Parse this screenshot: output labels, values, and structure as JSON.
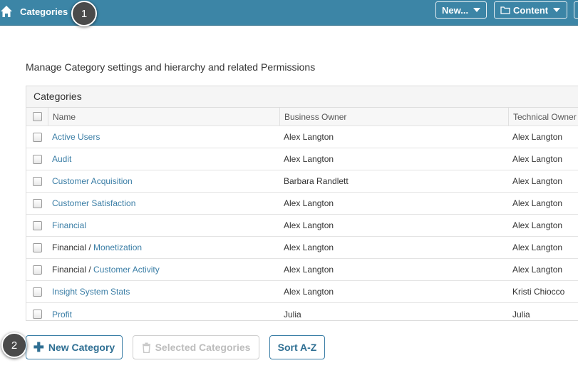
{
  "topbar": {
    "breadcrumb": "Categories",
    "new_label": "New...",
    "content_label": "Content"
  },
  "steps": {
    "one": "1",
    "two": "2"
  },
  "intro": "Manage Category settings and hierarchy and related Permissions",
  "table": {
    "title": "Categories",
    "columns": [
      "Name",
      "Business Owner",
      "Technical Owner"
    ],
    "rows": [
      {
        "prefix": "",
        "name": "Active Users",
        "business_owner": "Alex Langton",
        "technical_owner": "Alex Langton"
      },
      {
        "prefix": "",
        "name": "Audit",
        "business_owner": "Alex Langton",
        "technical_owner": "Alex Langton"
      },
      {
        "prefix": "",
        "name": "Customer Acquisition",
        "business_owner": "Barbara Randlett",
        "technical_owner": "Alex Langton"
      },
      {
        "prefix": "",
        "name": "Customer Satisfaction",
        "business_owner": "Alex Langton",
        "technical_owner": "Alex Langton"
      },
      {
        "prefix": "",
        "name": "Financial",
        "business_owner": "Alex Langton",
        "technical_owner": "Alex Langton"
      },
      {
        "prefix": "Financial / ",
        "name": "Monetization",
        "business_owner": "Alex Langton",
        "technical_owner": "Alex Langton"
      },
      {
        "prefix": "Financial / ",
        "name": "Customer Activity",
        "business_owner": "Alex Langton",
        "technical_owner": "Alex Langton"
      },
      {
        "prefix": "",
        "name": "Insight System Stats",
        "business_owner": "Alex Langton",
        "technical_owner": "Kristi Chiocco"
      },
      {
        "prefix": "",
        "name": "Profit",
        "business_owner": "Julia",
        "technical_owner": "Julia"
      }
    ]
  },
  "actions": {
    "new_category": "New Category",
    "selected_categories": "Selected Categories",
    "sort": "Sort A-Z"
  },
  "colors": {
    "topbar": "#3c85a6",
    "link": "#3b7ea6"
  }
}
